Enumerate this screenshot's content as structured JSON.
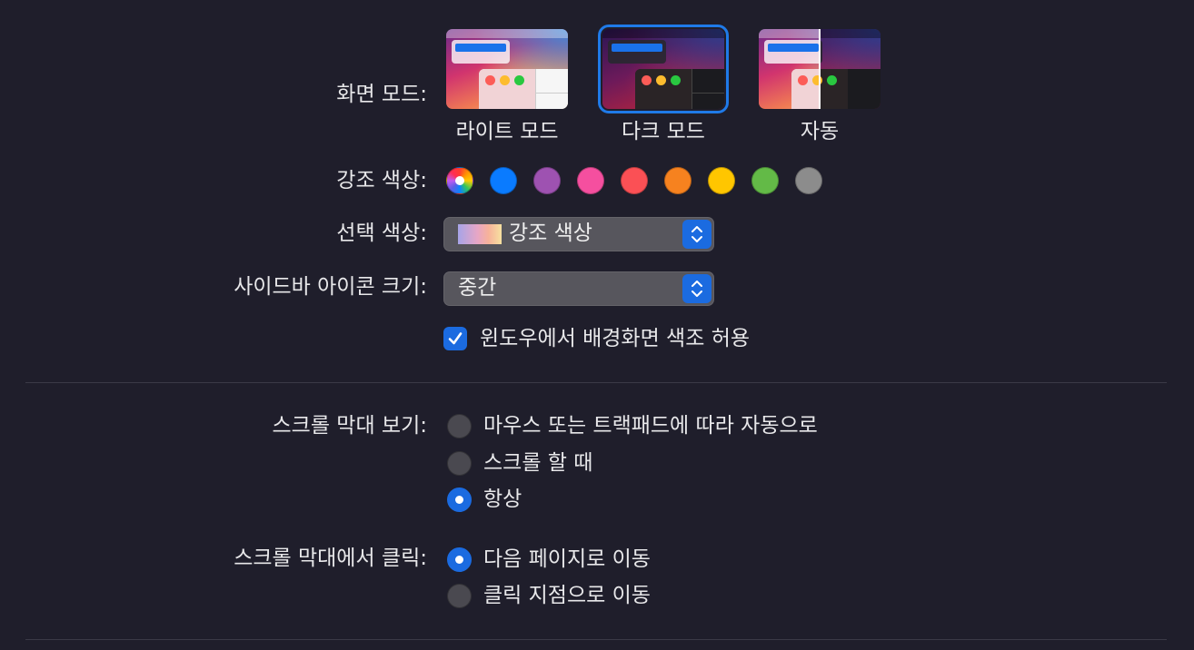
{
  "appearance": {
    "label": "화면 모드:",
    "options": [
      {
        "label": "라이트 모드",
        "selected": false
      },
      {
        "label": "다크 모드",
        "selected": true
      },
      {
        "label": "자동",
        "selected": false
      }
    ]
  },
  "accent": {
    "label": "강조 색상:",
    "colors": [
      {
        "name": "multicolor",
        "hex": "multicolor"
      },
      {
        "name": "blue",
        "hex": "#0a7bff"
      },
      {
        "name": "purple",
        "hex": "#9e52b1"
      },
      {
        "name": "pink",
        "hex": "#f54f9f"
      },
      {
        "name": "red",
        "hex": "#fb5055"
      },
      {
        "name": "orange",
        "hex": "#f6821f"
      },
      {
        "name": "yellow",
        "hex": "#ffc600"
      },
      {
        "name": "green",
        "hex": "#63ba47"
      },
      {
        "name": "graphite",
        "hex": "#8c8c8c"
      }
    ],
    "selected": "multicolor"
  },
  "highlight": {
    "label": "선택 색상:",
    "value": "강조 색상"
  },
  "sidebar_icon_size": {
    "label": "사이드바 아이콘 크기:",
    "value": "중간"
  },
  "wallpaper_tinting": {
    "label": "윈도우에서 배경화면 색조 허용",
    "checked": true
  },
  "show_scroll_bars": {
    "label": "스크롤 막대 보기:",
    "options": [
      {
        "label": "마우스 또는 트랙패드에 따라 자동으로",
        "selected": false
      },
      {
        "label": "스크롤 할 때",
        "selected": false
      },
      {
        "label": "항상",
        "selected": true
      }
    ]
  },
  "click_scroll_bar": {
    "label": "스크롤 막대에서 클릭:",
    "options": [
      {
        "label": "다음 페이지로 이동",
        "selected": true
      },
      {
        "label": "클릭 지점으로 이동",
        "selected": false
      }
    ]
  },
  "colors": {
    "background": "#1f1e2b",
    "accent_blue": "#1b6be0"
  }
}
